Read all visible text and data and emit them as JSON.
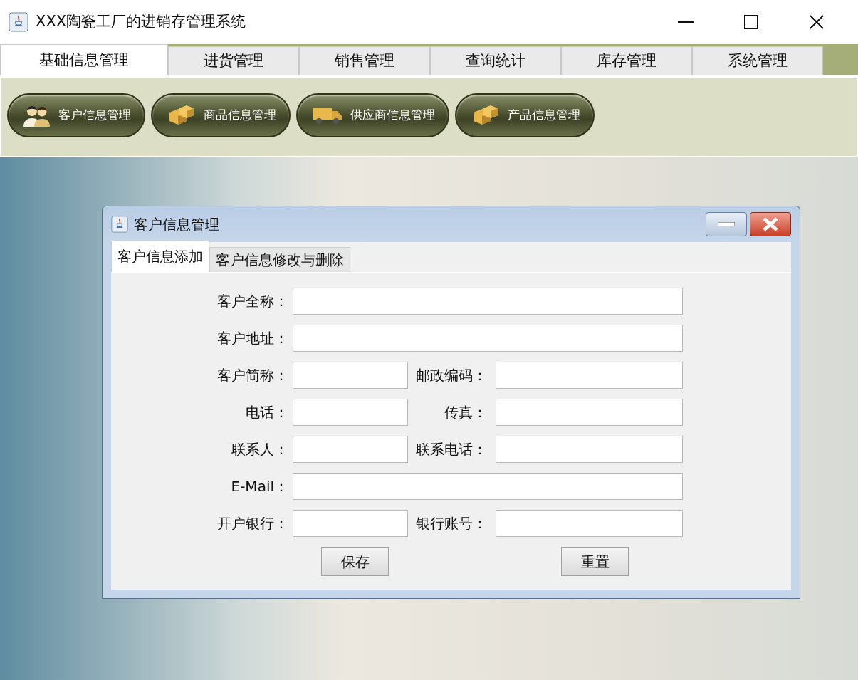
{
  "window": {
    "title": "XXX陶瓷工厂的进销存管理系统"
  },
  "tabs": [
    {
      "label": "基础信息管理",
      "selected": true
    },
    {
      "label": "进货管理",
      "selected": false
    },
    {
      "label": "销售管理",
      "selected": false
    },
    {
      "label": "查询统计",
      "selected": false
    },
    {
      "label": "库存管理",
      "selected": false
    },
    {
      "label": "系统管理",
      "selected": false
    }
  ],
  "toolbar": [
    {
      "label": "客户信息管理",
      "kind": "people"
    },
    {
      "label": "商品信息管理",
      "kind": "boxes"
    },
    {
      "label": "供应商信息管理",
      "kind": "truck"
    },
    {
      "label": "产品信息管理",
      "kind": "boxes"
    }
  ],
  "dialog": {
    "title": "客户信息管理",
    "tabs": [
      {
        "label": "客户信息添加",
        "selected": true
      },
      {
        "label": "客户信息修改与删除",
        "selected": false
      }
    ],
    "rows": [
      {
        "fields": [
          {
            "label": "客户全称："
          }
        ]
      },
      {
        "fields": [
          {
            "label": "客户地址："
          }
        ]
      },
      {
        "fields": [
          {
            "label": "客户简称："
          },
          {
            "label": "邮政编码："
          }
        ]
      },
      {
        "fields": [
          {
            "label": "电话："
          },
          {
            "label": "传真："
          }
        ]
      },
      {
        "fields": [
          {
            "label": "联系人："
          },
          {
            "label": "联系电话："
          }
        ]
      },
      {
        "fields": [
          {
            "label": "E-Mail："
          }
        ]
      },
      {
        "fields": [
          {
            "label": "开户银行："
          },
          {
            "label": "银行账号："
          }
        ]
      }
    ],
    "buttons": [
      "保存",
      "重置"
    ]
  }
}
